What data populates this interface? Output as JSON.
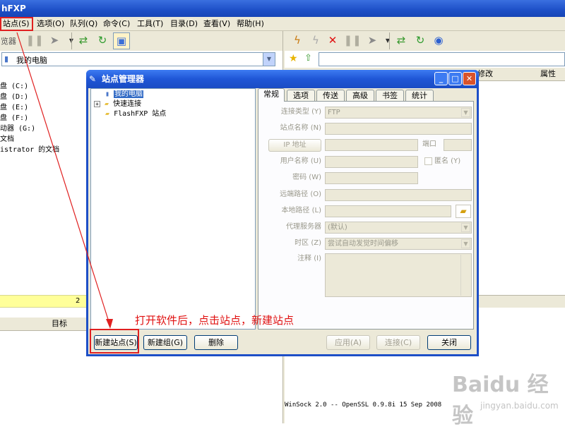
{
  "window": {
    "title": "hFXP"
  },
  "menu": [
    "站点(S)",
    "选项(O)",
    "队列(Q)",
    "命令(C)",
    "工具(T)",
    "目录(D)",
    "查看(V)",
    "帮助(H)"
  ],
  "left": {
    "browser_label": "览器",
    "address": "我的电脑",
    "items": [
      "盘 (C:)",
      "盘 (D:)",
      "盘 (E:)",
      "盘 (F:)",
      "动器 (G:)",
      "文档",
      "istrator 的文档"
    ],
    "status_text": "2 ",
    "queue_header": "目标"
  },
  "right": {
    "col_modified": "修改",
    "col_attr": "属性",
    "log_line": "WinSock 2.0 -- OpenSSL 0.9.8i 15 Sep 2008"
  },
  "dialog": {
    "title": "站点管理器",
    "tree": [
      "我的电脑",
      "快速连接",
      "FlashFXP 站点"
    ],
    "tabs": [
      "常规",
      "选项",
      "传送",
      "高级",
      "书签",
      "统计"
    ],
    "fields": {
      "conn_type_label": "连接类型 (Y)",
      "conn_type_value": "FTP",
      "site_name_label": "站点名称 (N)",
      "ip_button": "IP 地址",
      "port_label": "端口",
      "user_label": "用户名称 (U)",
      "anon_label": "匿名 (Y)",
      "pass_label": "密码 (W)",
      "remote_label": "远端路径 (O)",
      "local_label": "本地路径 (L)",
      "proxy_label": "代理服务器",
      "proxy_value": "(默认)",
      "tz_label": "时区 (Z)",
      "tz_value": "尝试自动发觉时间偏移",
      "notes_label": "注释 (I)"
    },
    "buttons": {
      "new_site": "新建站点(S)",
      "new_group": "新建组(G)",
      "delete": "删除",
      "apply": "应用(A)",
      "connect": "连接(C)",
      "close": "关闭"
    }
  },
  "annotation": "打开软件后，点击站点，新建站点",
  "watermark": {
    "main": "Baidu 经验",
    "sub": "jingyan.baidu.com"
  },
  "colors": {
    "annotation": "#e01010",
    "titlebar": "#1d4fc7"
  }
}
